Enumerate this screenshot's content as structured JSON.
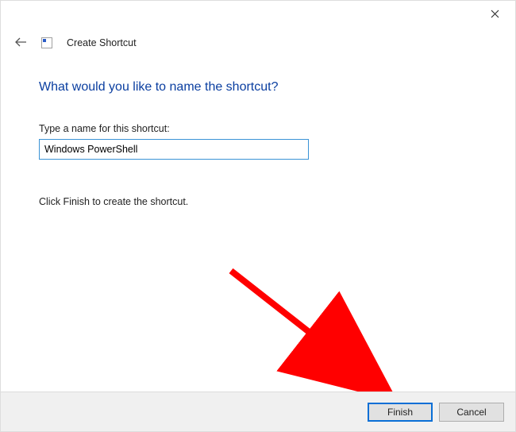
{
  "header": {
    "wizard_title": "Create Shortcut"
  },
  "main": {
    "heading": "What would you like to name the shortcut?",
    "field_label": "Type a name for this shortcut:",
    "shortcut_name_value": "Windows PowerShell",
    "instruction": "Click Finish to create the shortcut."
  },
  "footer": {
    "finish_label": "Finish",
    "cancel_label": "Cancel"
  }
}
